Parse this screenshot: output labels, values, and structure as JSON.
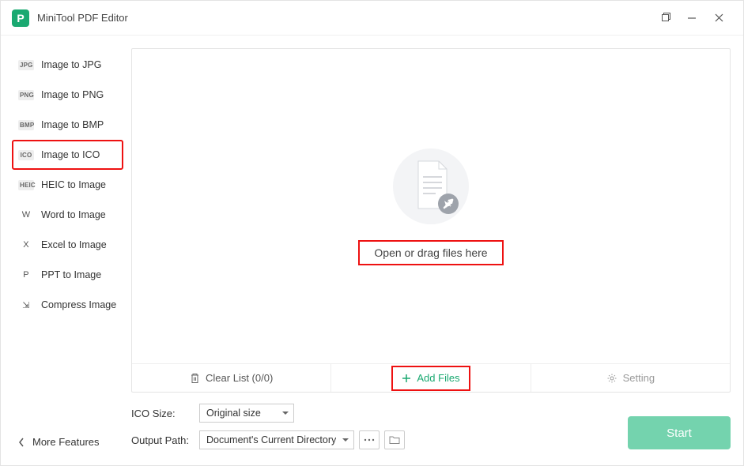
{
  "title": "MiniTool PDF Editor",
  "sidebar": {
    "items": [
      {
        "badge": "JPG",
        "label": "Image to JPG",
        "highlighted": false
      },
      {
        "badge": "PNG",
        "label": "Image to PNG",
        "highlighted": false
      },
      {
        "badge": "BMP",
        "label": "Image to BMP",
        "highlighted": false
      },
      {
        "badge": "ICO",
        "label": "Image to ICO",
        "highlighted": true
      },
      {
        "badge": "HEIC",
        "label": "HEIC to Image",
        "highlighted": false
      },
      {
        "badge": "W",
        "label": "Word to Image",
        "letter": true
      },
      {
        "badge": "X",
        "label": "Excel to Image",
        "letter": true
      },
      {
        "badge": "P",
        "label": "PPT to Image",
        "letter": true
      },
      {
        "badge": "⇲",
        "label": "Compress Image",
        "letter": true
      }
    ],
    "more": "More Features"
  },
  "drop": {
    "text": "Open or drag files here"
  },
  "actions": {
    "clear": "Clear List (0/0)",
    "add": "Add Files",
    "setting": "Setting"
  },
  "controls": {
    "ico_size_label": "ICO Size:",
    "ico_size_value": "Original size",
    "output_label": "Output Path:",
    "output_value": "Document's Current Directory"
  },
  "start": "Start"
}
